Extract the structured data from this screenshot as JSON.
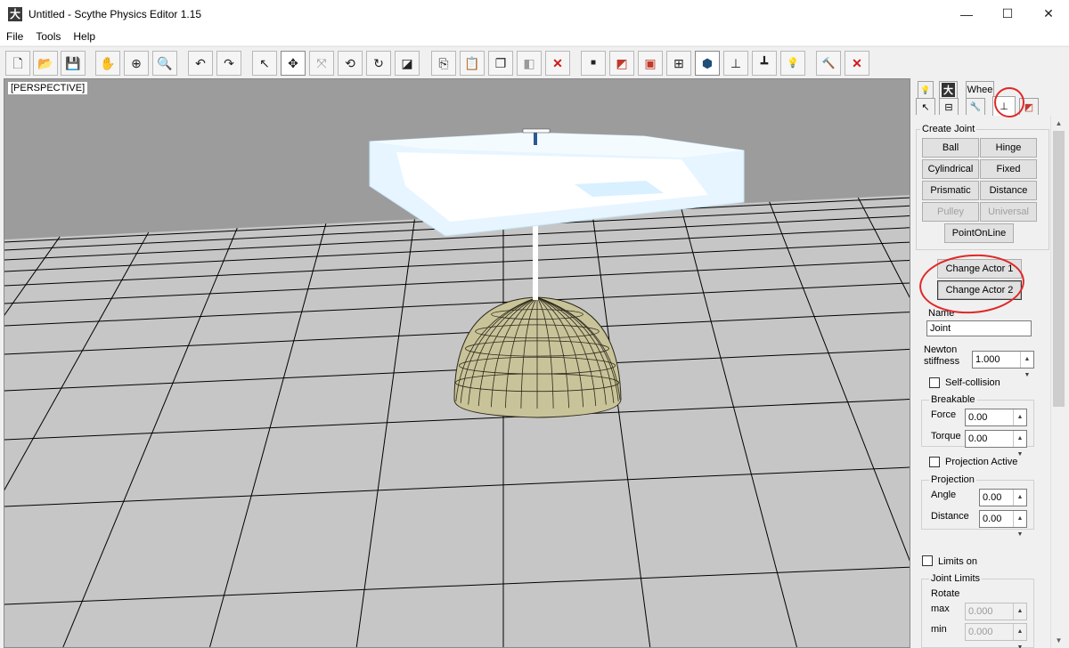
{
  "window": {
    "title": "Untitled - Scythe Physics Editor 1.15",
    "app_icon_glyph": "大",
    "minimize_glyph": "—",
    "maximize_glyph": "☐",
    "close_glyph": "✕"
  },
  "menu": [
    "File",
    "Tools",
    "Help"
  ],
  "toolbar": [
    {
      "name": "new-file-icon",
      "glyph": "🗋"
    },
    {
      "name": "open-folder-icon",
      "glyph": "📂"
    },
    {
      "name": "save-disk-icon",
      "glyph": "💾"
    },
    {
      "name": "pan-hand-icon",
      "glyph": "✋"
    },
    {
      "name": "orbit-crosshair-icon",
      "glyph": "⊕"
    },
    {
      "name": "zoom-magnifier-icon",
      "glyph": "🔍"
    },
    {
      "name": "undo-icon",
      "glyph": "↶"
    },
    {
      "name": "redo-icon",
      "glyph": "↷"
    },
    {
      "name": "select-arrow-icon",
      "glyph": "↖"
    },
    {
      "name": "move-arrows-icon",
      "glyph": "✥"
    },
    {
      "name": "scale-arrows-icon",
      "glyph": "⤧"
    },
    {
      "name": "rotate-local-icon",
      "glyph": "⟲"
    },
    {
      "name": "rotate-icon",
      "glyph": "↻"
    },
    {
      "name": "bounds-box-icon",
      "glyph": "◪"
    },
    {
      "name": "copy-icon",
      "glyph": "⎘"
    },
    {
      "name": "paste-icon",
      "glyph": "📋"
    },
    {
      "name": "duplicate-icon",
      "glyph": "❐"
    },
    {
      "name": "mirror-icon",
      "glyph": "◧"
    },
    {
      "name": "delete-icon",
      "glyph": "✕"
    },
    {
      "name": "small-box-icon",
      "glyph": "■"
    },
    {
      "name": "actor-box-icon",
      "glyph": "◩"
    },
    {
      "name": "shape-box-icon",
      "glyph": "▣"
    },
    {
      "name": "add-shape-icon",
      "glyph": "⊞"
    },
    {
      "name": "joint-marker-icon",
      "glyph": "⬢"
    },
    {
      "name": "joint-anchor-icon",
      "glyph": "⊥"
    },
    {
      "name": "joint-axis-icon",
      "glyph": "┻"
    },
    {
      "name": "light-bulb-icon",
      "glyph": "💡"
    },
    {
      "name": "hammer-icon",
      "glyph": "🔨"
    },
    {
      "name": "delete-all-icon",
      "glyph": "✕"
    }
  ],
  "viewport": {
    "label": "[PERSPECTIVE]"
  },
  "tabs": {
    "row1": [
      {
        "name": "tab-lights",
        "glyph": "💡"
      },
      {
        "name": "tab-character",
        "glyph": "大"
      },
      {
        "name": "tab-wheel",
        "label": "Whee"
      }
    ],
    "row2": [
      {
        "name": "tab-select",
        "glyph": "↖"
      },
      {
        "name": "tab-hierarchy",
        "glyph": "⊟"
      },
      {
        "name": "tab-tools",
        "glyph": "🔧"
      },
      {
        "name": "tab-joints",
        "glyph": "⊥"
      },
      {
        "name": "tab-materials",
        "glyph": "◩"
      }
    ]
  },
  "create_joint": {
    "label": "Create Joint",
    "buttons": [
      {
        "label": "Ball",
        "enabled": true
      },
      {
        "label": "Hinge",
        "enabled": true
      },
      {
        "label": "Cylindrical",
        "enabled": true
      },
      {
        "label": "Fixed",
        "enabled": true
      },
      {
        "label": "Prismatic",
        "enabled": true
      },
      {
        "label": "Distance",
        "enabled": true
      },
      {
        "label": "Pulley",
        "enabled": false
      },
      {
        "label": "Universal",
        "enabled": false
      },
      {
        "label": "PointOnLine",
        "enabled": true
      }
    ]
  },
  "actors": {
    "change_actor_1": "Change Actor 1",
    "change_actor_2": "Change Actor 2"
  },
  "name_field": {
    "label": "Name",
    "value": "Joint"
  },
  "stiffness": {
    "label1": "Newton",
    "label2": "stiffness",
    "value": "1.000"
  },
  "self_collision": {
    "label": "Self-collision",
    "checked": false
  },
  "breakable": {
    "label": "Breakable",
    "force_label": "Force",
    "force_value": "0.00",
    "torque_label": "Torque",
    "torque_value": "0.00"
  },
  "projection_active": {
    "label": "Projection Active",
    "checked": false
  },
  "projection": {
    "label": "Projection",
    "angle_label": "Angle",
    "angle_value": "0.00",
    "distance_label": "Distance",
    "distance_value": "0.00"
  },
  "limits_on": {
    "label": "Limits on",
    "checked": false
  },
  "joint_limits": {
    "label": "Joint Limits",
    "rotate_label": "Rotate",
    "max_label": "max",
    "max_value": "0.000",
    "min_label": "min",
    "min_value": "0.000"
  },
  "colors": {
    "viewport_sky": "#9c9c9c",
    "floor": "#c6c6c6",
    "ice_box": "#eaf7ff",
    "dome": "#c9c39a",
    "annotation": "#e02828"
  }
}
